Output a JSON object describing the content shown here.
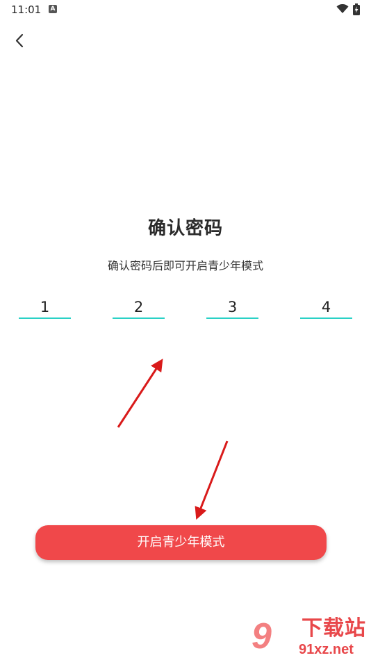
{
  "status_bar": {
    "time": "11:01",
    "notification_icon_label": "A"
  },
  "header": {
    "back_icon": "chevron-left-icon"
  },
  "main": {
    "title": "确认密码",
    "subtitle": "确认密码后即可开启青少年模式",
    "pin_digits": [
      "1",
      "2",
      "3",
      "4"
    ],
    "submit_label": "开启青少年模式"
  },
  "watermark": {
    "logo_text": "9",
    "site_name": "下载站",
    "site_url": "91xz.net"
  },
  "colors": {
    "accent_underline": "#2ad1c6",
    "button_bg": "#f0484a",
    "arrow": "#d91a1a"
  }
}
